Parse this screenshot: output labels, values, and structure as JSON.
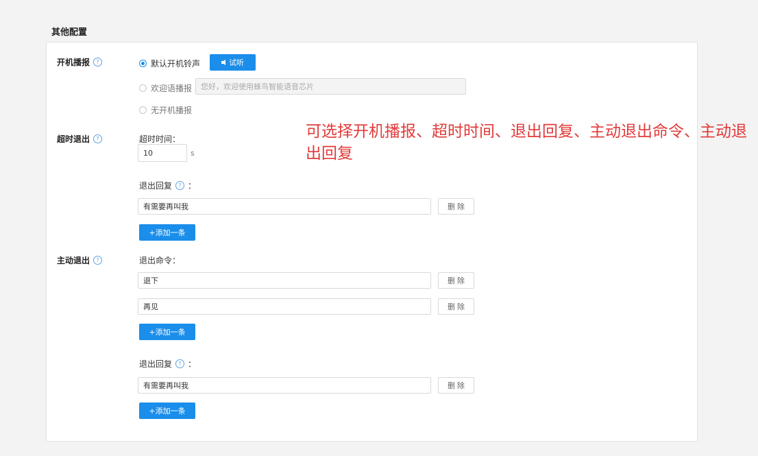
{
  "section_title": "其他配置",
  "boot_broadcast": {
    "label": "开机播报",
    "options": [
      {
        "label": "默认开机铃声",
        "checked": true
      },
      {
        "label": "欢迎语播报",
        "checked": false
      },
      {
        "label": "无开机播报",
        "checked": false
      }
    ],
    "listen_button": "试听",
    "welcome_placeholder": "您好，欢迎使用蜂鸟智能语音芯片"
  },
  "timeout_exit": {
    "label": "超时退出",
    "timeout_label": "超时时间：",
    "timeout_value": "10",
    "timeout_unit": "s",
    "reply_label": "退出回复",
    "reply_colon": "：",
    "replies": [
      "有需要再叫我"
    ],
    "delete_label": "删除",
    "add_label": "+添加一条"
  },
  "active_exit": {
    "label": "主动退出",
    "command_label": "退出命令：",
    "commands": [
      "退下",
      "再见"
    ],
    "reply_label": "退出回复",
    "reply_colon": "：",
    "replies": [
      "有需要再叫我"
    ],
    "delete_label": "删除",
    "add_label": "+添加一条"
  },
  "annotation": "可选择开机播报、超时时间、退出回复、主动退出命令、主动退出回复",
  "colors": {
    "accent": "#1a8eea",
    "annotation": "#e23a3a",
    "background": "#f3f3f3"
  },
  "icons": {
    "help": "question-circle-icon",
    "listen": "speaker-icon"
  }
}
